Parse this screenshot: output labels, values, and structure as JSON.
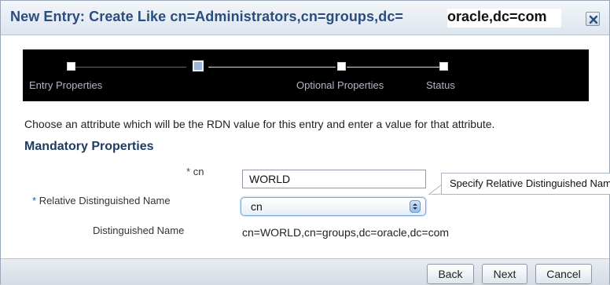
{
  "dialog": {
    "title": "New Entry: Create Like cn=Administrators,cn=groups,dc=",
    "title_suffix": "oracle,dc=com",
    "close_icon": "close-icon"
  },
  "train": {
    "steps": [
      {
        "label": "Entry Properties",
        "current": false
      },
      {
        "label": "",
        "current": true
      },
      {
        "label": "Optional Properties",
        "current": false
      },
      {
        "label": "Status",
        "current": false
      }
    ]
  },
  "instruction": "Choose an attribute which will be the RDN value for this entry and enter a value for that attribute.",
  "section_title": "Mandatory Properties",
  "fields": {
    "cn": {
      "required_mark": "*",
      "label": "cn",
      "value": "WORLD"
    },
    "rdn": {
      "required_mark": "*",
      "label": "Relative Distinguished Name",
      "value": "cn"
    },
    "dn": {
      "label": "Distinguished Name",
      "value": "cn=WORLD,cn=groups,dc=oracle,dc=com"
    }
  },
  "tooltip": "Specify Relative Distinguished Name",
  "buttons": {
    "back": "Back",
    "next": "Next",
    "cancel": "Cancel"
  },
  "colors": {
    "title": "#2a4d80",
    "train_bg": "#000000",
    "required": "#1f5ea8"
  }
}
